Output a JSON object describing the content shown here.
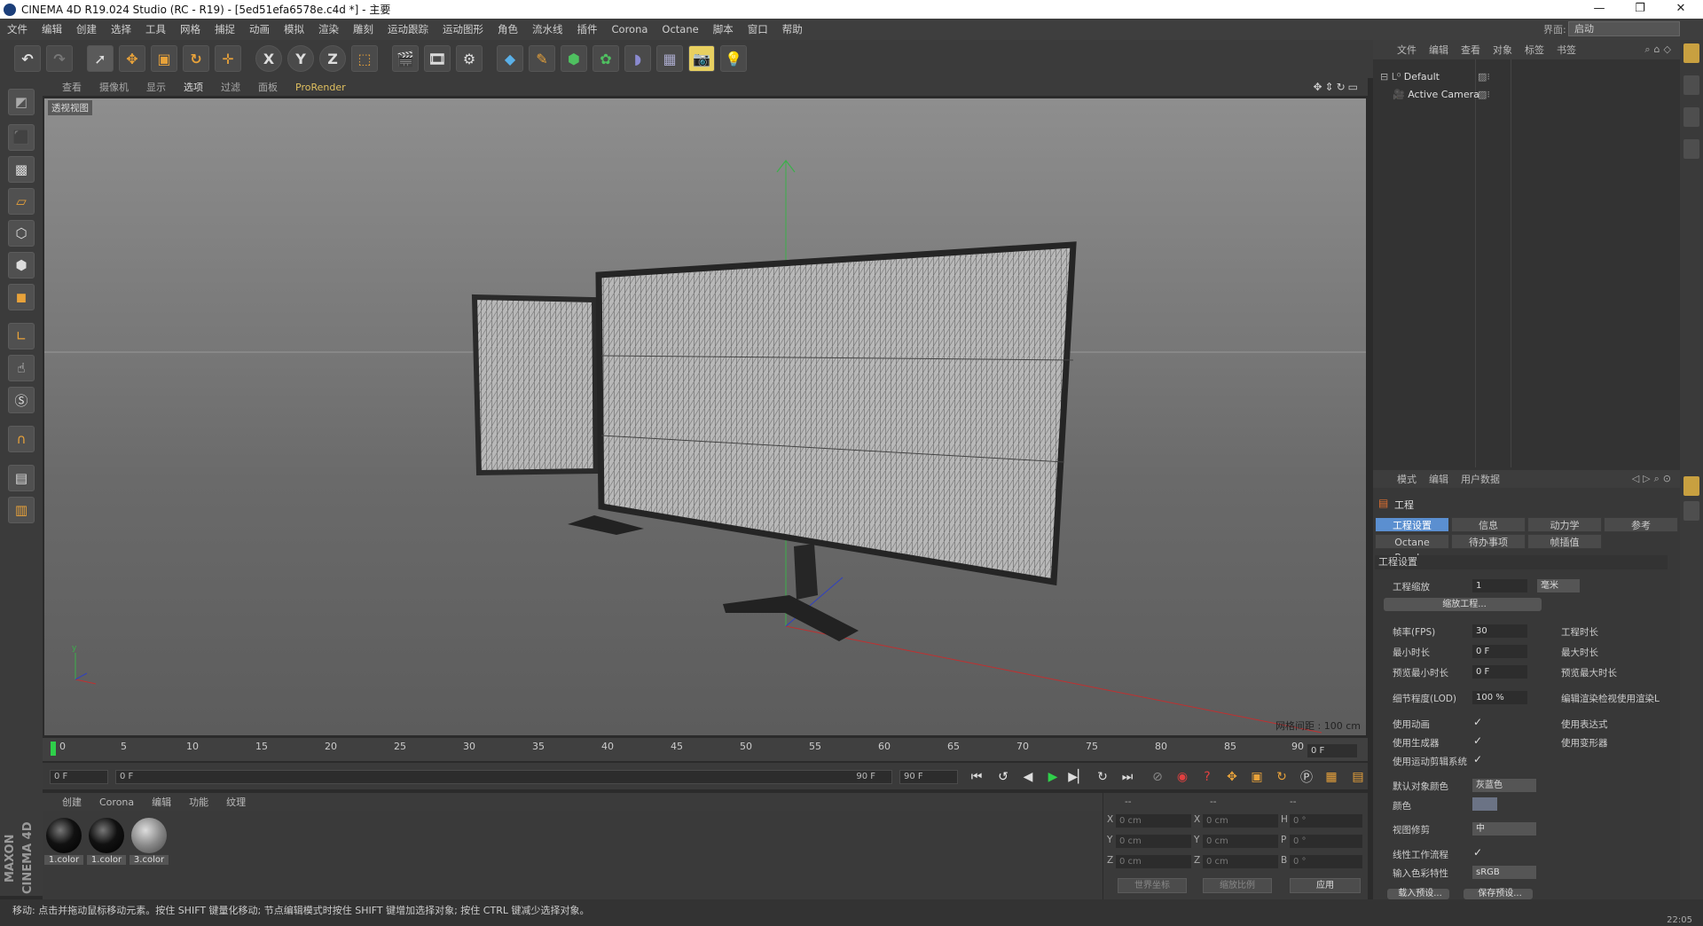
{
  "window": {
    "title": "CINEMA 4D R19.024 Studio (RC - R19) - [5ed51efa6578e.c4d *] - 主要",
    "controls": [
      "—",
      "❐",
      "✕"
    ]
  },
  "menu": {
    "items": [
      "文件",
      "编辑",
      "创建",
      "选择",
      "工具",
      "网格",
      "捕捉",
      "动画",
      "模拟",
      "渲染",
      "雕刻",
      "运动跟踪",
      "运动图形",
      "角色",
      "流水线",
      "插件",
      "Corona",
      "Octane",
      "脚本",
      "窗口",
      "帮助"
    ],
    "layout_label": "界面:",
    "layout_value": "启动"
  },
  "viewport": {
    "menu": [
      "查看",
      "摄像机",
      "显示",
      "选项",
      "过滤",
      "面板"
    ],
    "render_engine": "ProRender",
    "label": "透视视图",
    "grid_info": "网格间距 : 100 cm"
  },
  "timeline": {
    "ticks": [
      "0",
      "5",
      "10",
      "15",
      "20",
      "25",
      "30",
      "35",
      "40",
      "45",
      "50",
      "55",
      "60",
      "65",
      "70",
      "75",
      "80",
      "85",
      "90"
    ],
    "current_frame": "0 F"
  },
  "transport": {
    "start": "0 F",
    "slider_start": "0 F",
    "slider_end": "90 F",
    "end": "90 F"
  },
  "materials": {
    "menu": [
      "创建",
      "Corona",
      "编辑",
      "功能",
      "纹理"
    ],
    "items": [
      {
        "label": "1.color"
      },
      {
        "label": "1.color"
      },
      {
        "label": "3.color"
      }
    ]
  },
  "coordinates": {
    "header": [
      "--",
      "--",
      "--"
    ],
    "rows": [
      {
        "a": "X",
        "av": "0 cm",
        "b": "X",
        "bv": "0 cm",
        "c": "H",
        "cv": "0 °"
      },
      {
        "a": "Y",
        "av": "0 cm",
        "b": "Y",
        "bv": "0 cm",
        "c": "P",
        "cv": "0 °"
      },
      {
        "a": "Z",
        "av": "0 cm",
        "b": "Z",
        "bv": "0 cm",
        "c": "B",
        "cv": "0 °"
      }
    ],
    "mode1": "世界坐标",
    "mode2": "缩放比例",
    "apply": "应用"
  },
  "status": {
    "text": "移动: 点击并拖动鼠标移动元素。按住 SHIFT 键量化移动; 节点编辑模式时按住 SHIFT 键增加选择对象; 按住 CTRL 键减少选择对象。",
    "time": "22:05"
  },
  "object_manager": {
    "menu": [
      "文件",
      "编辑",
      "查看",
      "对象",
      "标签",
      "书签"
    ],
    "objects": [
      "Default",
      "Active Camera"
    ]
  },
  "attributes": {
    "menu": [
      "模式",
      "编辑",
      "用户数据"
    ],
    "title": "工程",
    "tabs_row1": [
      "工程设置",
      "信息",
      "动力学",
      "参考"
    ],
    "tabs_row2": [
      "Octane Render",
      "待办事项",
      "帧插值"
    ],
    "section": "工程设置",
    "scale_label": "工程缩放",
    "scale_value": "1",
    "scale_unit": "毫米",
    "scale_button": "缩放工程...",
    "fps_label": "帧率(FPS)",
    "fps_value": "30",
    "duration_label": "工程时长",
    "min_time_label": "最小时长",
    "min_time_value": "0 F",
    "max_time_label": "最大时长",
    "prev_min_label": "预览最小时长",
    "prev_min_value": "0 F",
    "prev_max_label": "预览最大时长",
    "lod_label": "细节程度(LOD)",
    "lod_value": "100 %",
    "lod_render_label": "编辑渲染检视使用渲染L",
    "use_anim_label": "使用动画",
    "use_expr_label": "使用表达式",
    "use_gen_label": "使用生成器",
    "use_deform_label": "使用变形器",
    "use_motion_label": "使用运动剪辑系统",
    "default_color_label": "默认对象颜色",
    "default_color_value": "灰蓝色",
    "color_label": "颜色",
    "clip_label": "视图修剪",
    "clip_value": "中",
    "linear_label": "线性工作流程",
    "input_color_label": "输入色彩特性",
    "input_color_value": "sRGB",
    "load_preset": "载入预设...",
    "save_preset": "保存预设..."
  }
}
